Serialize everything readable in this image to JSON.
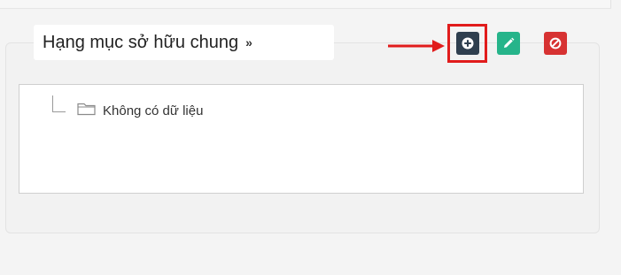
{
  "panel": {
    "title": "Hạng mục sở hữu chung",
    "collapse_icon": "double-chevron-up-icon"
  },
  "tree": {
    "empty_label": "Không có dữ liệu",
    "folder_icon": "folder-outline-icon"
  },
  "toolbar": {
    "add_icon": "plus-circle-icon",
    "edit_icon": "pencil-icon",
    "cancel_icon": "ban-icon"
  },
  "annotation": {
    "color": "#e11c1c"
  },
  "colors": {
    "add": "#2f3f4f",
    "edit": "#26b48a",
    "cancel": "#d73232"
  }
}
